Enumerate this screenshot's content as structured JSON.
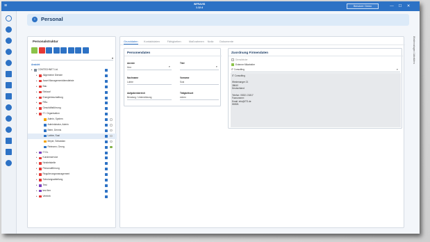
{
  "titlebar": {
    "app_name": "INFRAVIS",
    "app_version": "1.12.4",
    "user_button": "Benutzer: Demo",
    "minimize": "—",
    "maximize": "☐",
    "close": "✕"
  },
  "header": {
    "title": "Personal",
    "icon": "info-icon"
  },
  "left_panel": {
    "title": "Personalstruktur",
    "dropdown_arrow": "▾",
    "tree_label": "Ansicht",
    "toolbar": [
      {
        "name": "add-button",
        "color": "#8bc34a"
      },
      {
        "name": "delete-button",
        "color": "#e53935"
      },
      {
        "name": "edit-button",
        "color": "#2d72c5"
      },
      {
        "name": "sort-button",
        "color": "#2d72c5"
      },
      {
        "name": "export-button",
        "color": "#2d72c5"
      },
      {
        "name": "search-button",
        "color": "#2d72c5"
      },
      {
        "name": "print-button",
        "color": "#2d72c5"
      },
      {
        "name": "settings-button",
        "color": "#2d72c5"
      }
    ],
    "tree": [
      {
        "label": "CONTECHNET Ltd.",
        "level": 0,
        "icon": "#7a8a9a",
        "badge": true,
        "dot": ""
      },
      {
        "label": "Allgemeine Dienste",
        "level": 1,
        "icon": "#e53935",
        "badge": true,
        "dot": ""
      },
      {
        "label": "Asset Managementdienstleiste",
        "level": 1,
        "icon": "#e53935",
        "badge": true,
        "dot": ""
      },
      {
        "label": "Bau",
        "level": 1,
        "icon": "#e53935",
        "badge": true,
        "dot": ""
      },
      {
        "label": "Einkauf",
        "level": 1,
        "icon": "#e53935",
        "badge": true,
        "dot": ""
      },
      {
        "label": "Energiebeschaffung",
        "level": 1,
        "icon": "#e53935",
        "badge": true,
        "dot": ""
      },
      {
        "label": "FiBu",
        "level": 1,
        "icon": "#e53935",
        "badge": true,
        "dot": ""
      },
      {
        "label": "Geschäftsführung",
        "level": 1,
        "icon": "#e53935",
        "badge": true,
        "dot": ""
      },
      {
        "label": "IT / Organisation",
        "level": 1,
        "icon": "#e53935",
        "badge": true,
        "dot": ""
      },
      {
        "label": "Admin, System",
        "level": 2,
        "icon": "#f4a300",
        "badge": true,
        "dot": "empty"
      },
      {
        "label": "Administrator, Admin",
        "level": 2,
        "icon": "#2d72c5",
        "badge": true,
        "dot": "empty"
      },
      {
        "label": "Beier, Dennis",
        "level": 2,
        "icon": "#2d72c5",
        "badge": true,
        "dot": "empty"
      },
      {
        "label": "Lobbe, Susi",
        "level": 2,
        "icon": "#2d72c5",
        "badge": true,
        "dot": "empty",
        "selected": true
      },
      {
        "label": "Meyer, Sebastian",
        "level": 2,
        "icon": "#f4a300",
        "badge": true,
        "dot": "empty"
      },
      {
        "label": "Reimann, Georg",
        "level": 2,
        "icon": "#2d72c5",
        "badge": true,
        "dot": "green",
        "lock": true
      },
      {
        "label": "IT DL",
        "level": 1,
        "icon": "#7b3fbf",
        "badge": true,
        "dot": ""
      },
      {
        "label": "Kundenservice",
        "level": 1,
        "icon": "#e53935",
        "badge": true,
        "dot": ""
      },
      {
        "label": "Netzleitstelle",
        "level": 1,
        "icon": "#e53935",
        "badge": true,
        "dot": ""
      },
      {
        "label": "Personalführung",
        "level": 1,
        "icon": "#e53935",
        "badge": true,
        "dot": ""
      },
      {
        "label": "Regulierungsmanagement",
        "level": 1,
        "icon": "#e53935",
        "badge": true,
        "dot": ""
      },
      {
        "label": "Schulungsabteilung",
        "level": 1,
        "icon": "#e53935",
        "badge": true,
        "dot": ""
      },
      {
        "label": "Test",
        "level": 1,
        "icon": "#7b3fbf",
        "badge": true,
        "dot": ""
      },
      {
        "label": "test firm",
        "level": 1,
        "icon": "#7b3fbf",
        "badge": true,
        "dot": ""
      },
      {
        "label": "Vertrieb",
        "level": 1,
        "icon": "#e53935",
        "badge": true,
        "dot": ""
      }
    ]
  },
  "main": {
    "tabs": [
      "Grunddaten",
      "Kontaktdaten",
      "Fähigkeiten",
      "Maßnahmen",
      "Notiz",
      "Dokumente"
    ],
    "active_tab": "Grunddaten",
    "personendaten": {
      "title": "Personendaten",
      "anrede_label": "Anrede",
      "anrede_value": "Herr",
      "titel_label": "Titel",
      "titel_value": "",
      "nachname_label": "Nachname",
      "nachname_value": "Lobbe",
      "vorname_label": "Vorname",
      "vorname_value": "Susi",
      "aufgabe_label": "Aufgabenbereich",
      "aufgabe_value": "Beratung / Unterstützung",
      "taetigkeit_label": "Tätigkeitsort",
      "taetigkeit_value": "extern",
      "arrow": "▾"
    },
    "firmendaten": {
      "title": "Zuordnung Firmendaten",
      "dienstleister_label": "Dienstleister",
      "extern_label": "Externer Mitarbeiter",
      "firma_value": "IT Consulting",
      "address_lines": [
        "IT Consulting",
        "",
        "Westenanger 21",
        "38640",
        "Deutschland",
        "",
        "Telefon:     05321 21817",
        "Faxnummer:",
        "Email:       info@ITS.de",
        "WWW:"
      ],
      "arrow": "▾"
    }
  },
  "right_strip": {
    "vertical_label": "Wiedervorlagen / Aktivitäten"
  }
}
